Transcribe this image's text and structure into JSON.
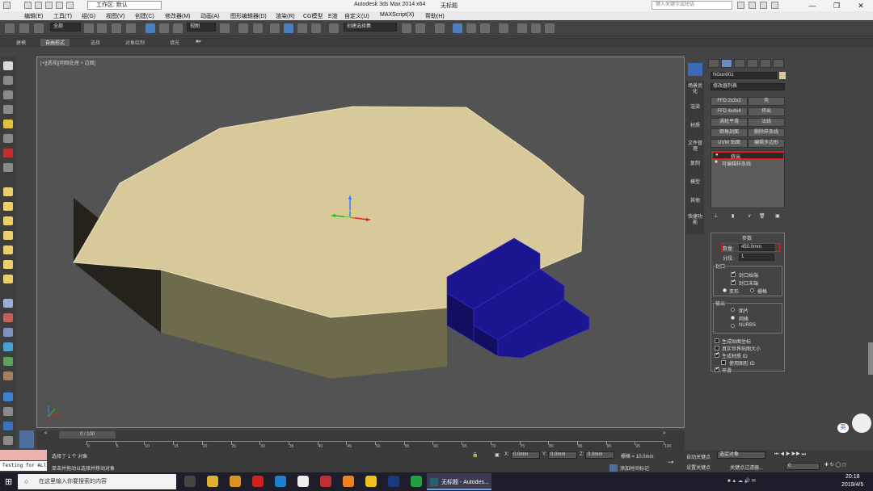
{
  "titlebar": {
    "workspace": "工作区: 默认",
    "app_title": "Autodesk 3ds Max  2014 x64",
    "doc_title": "无标题",
    "search_placeholder": "键入关键字或短语"
  },
  "menu": [
    "编辑(E)",
    "工具(T)",
    "组(G)",
    "视图(V)",
    "创建(C)",
    "修改器(M)",
    "动画(A)",
    "图形编辑器(D)",
    "渲染(R)",
    "CG模型",
    "E渲",
    "自定义(U)",
    "MAXScript(X)",
    "帮助(H)"
  ],
  "toolbar": {
    "selection_filter": "全部",
    "reference_coord": "视图",
    "named_selection": "创建选择集"
  },
  "ribbon_tabs": [
    {
      "label": "建模",
      "selected": false
    },
    {
      "label": "自由形式",
      "selected": true
    },
    {
      "label": "选择",
      "selected": false
    },
    {
      "label": "对象绘制",
      "selected": false
    },
    {
      "label": "填充",
      "selected": false
    }
  ],
  "viewport": {
    "label": "[+][透视][明暗处理 + 边面]"
  },
  "side_panel": [
    "场景优化",
    "渲染",
    "材质",
    "文件管理",
    "复制",
    "模型",
    "其他",
    "快捷功能"
  ],
  "command_panel": {
    "object_name": "NGon001",
    "modifier_list": "修改器列表",
    "modifier_buttons": [
      "FFD 2x2x2",
      "壳",
      "FFD 4x4x4",
      "挤出",
      "涡轮平滑",
      "法线",
      "倒角剖面",
      "删除样条线",
      "UVW 贴图",
      "编辑多边形"
    ],
    "stack": [
      "挤出",
      "可编辑样条线"
    ],
    "params_title": "参数",
    "amount_label": "数量:",
    "amount_value": "450.0mm",
    "segments_label": "分段:",
    "segments_value": "1",
    "capping_title": "封口",
    "cap_start": "封口始端",
    "cap_end": "封口末端",
    "morph": "变形",
    "grid": "栅格",
    "output_title": "输出",
    "output_patch": "面片",
    "output_mesh": "网格",
    "output_nurbs": "NURBS",
    "gen_map_coords": "生成贴图坐标",
    "real_world_map": "真实世界贴图大小",
    "gen_material_ids": "生成材质 ID",
    "use_shape_ids": "使用图形 ID",
    "smooth": "平滑"
  },
  "timeline": {
    "frame_counter": "0 / 100",
    "ticks": [
      "0",
      "5",
      "10",
      "15",
      "20",
      "25",
      "30",
      "35",
      "40",
      "45",
      "50",
      "55",
      "60",
      "65",
      "70",
      "75",
      "80",
      "85",
      "90",
      "95",
      "100"
    ]
  },
  "status": {
    "maxscript_label": "Testing for ALl",
    "line1": "选择了 1 个 对象",
    "line2": "单击并拖动以选择并移动对象",
    "x_label": "X:",
    "x_value": "0.0mm",
    "y_label": "Y:",
    "y_value": "0.0mm",
    "z_label": "Z:",
    "z_value": "0.0mm",
    "grid": "栅格 = 10.0mm",
    "add_time_tag": "添加时间标记",
    "auto_key": "自动关键点",
    "set_key": "设置关键点",
    "selected_object": "选定对象",
    "key_filters": "关键点过滤器...",
    "frame_value": "0"
  },
  "taskbar": {
    "search_placeholder": "在这里输入你要搜索的内容",
    "active_app": "无标题 - Autodes...",
    "time": "20:18",
    "date": "2019/4/5",
    "ime": "英"
  },
  "colors": {
    "ngon_top": "#d8c99a",
    "ngon_side": "#6b6548",
    "stairs": "#1c1590",
    "highlight": "#e01818"
  }
}
